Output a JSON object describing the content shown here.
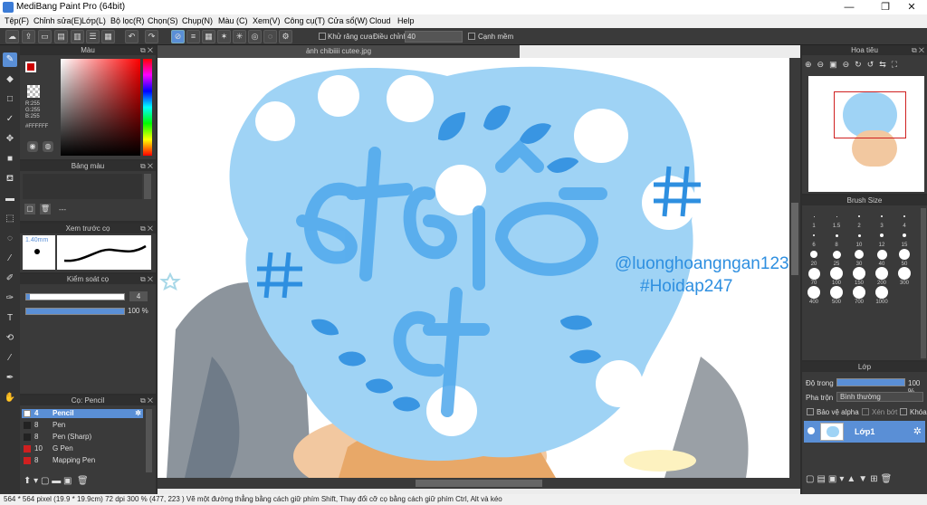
{
  "window": {
    "title": "MediBang Paint Pro (64bit)",
    "minimize": "—",
    "maximize": "❐",
    "close": "✕"
  },
  "menu": [
    "Tệp(F)",
    "Chỉnh sửa(E)",
    "Lớp(L)",
    "Bộ lọc(R)",
    "Chọn(S)",
    "Chụp(N)",
    "Màu (C)",
    "Xem(V)",
    "Công cụ(T)",
    "Cửa sổ(W)",
    "Cloud",
    "Help"
  ],
  "toolbar": {
    "antialias_label": "Khử răng cưa",
    "adjust_label": "Điều chỉnh",
    "adjust_value": "40",
    "snap_label": "Cạnh mềm"
  },
  "color_panel": {
    "title": "Màu",
    "r": "R:255",
    "g": "G:255",
    "b": "B:255",
    "hex": "#FFFFFF"
  },
  "palette_panel": {
    "title": "Bảng màu",
    "dots": "---"
  },
  "brush_preview": {
    "title": "Xem trước cọ",
    "size": "1.40mm"
  },
  "brush_control": {
    "title": "Kiểm soát cọ",
    "size_value": "4",
    "opacity_value": "100 %"
  },
  "brush_list": {
    "title": "Cọ: Pencil",
    "items": [
      {
        "num": "4",
        "name": "Pencil",
        "color": "#ffffff"
      },
      {
        "num": "8",
        "name": "Pen",
        "color": "#222222"
      },
      {
        "num": "8",
        "name": "Pen (Sharp)",
        "color": "#222222"
      },
      {
        "num": "10",
        "name": "G Pen",
        "color": "#d02020"
      },
      {
        "num": "8",
        "name": "Mapping Pen",
        "color": "#d02020"
      }
    ]
  },
  "document": {
    "tab": "ảnh chibiiii cutee.jpg"
  },
  "artwork": {
    "text1": "@luonghoangngan123",
    "text2": "#Hoidap247",
    "colors": {
      "blob": "#9fd3f5",
      "letters": "#4fa8ec",
      "sky": "#2e8fe0"
    }
  },
  "navigator": {
    "title": "Hoa tiêu"
  },
  "brush_size": {
    "title": "Brush Size",
    "sizes": [
      "1",
      "1.5",
      "2",
      "3",
      "4",
      "6",
      "8",
      "10",
      "12",
      "15",
      "20",
      "25",
      "30",
      "40",
      "50",
      "70",
      "100",
      "150",
      "200",
      "300",
      "400",
      "500",
      "700",
      "1000"
    ]
  },
  "layer_panel": {
    "title": "Lớp",
    "opacity_label": "Độ trong",
    "opacity_value": "100 %",
    "blend_label": "Pha trộn",
    "blend_value": "Bình thường",
    "protect_alpha": "Bảo vệ alpha",
    "clipping": "Xén bớt",
    "lock": "Khóa",
    "layer_name": "Lớp1"
  },
  "status": {
    "text": "564 * 564 pixel   (19.9 * 19.9cm)   72 dpi   300 %   (477, 223 )   Vẽ một đường thẳng bằng cách giữ phím Shift, Thay đổi cỡ cọ bằng cách giữ phím Ctrl, Alt và kéo"
  }
}
